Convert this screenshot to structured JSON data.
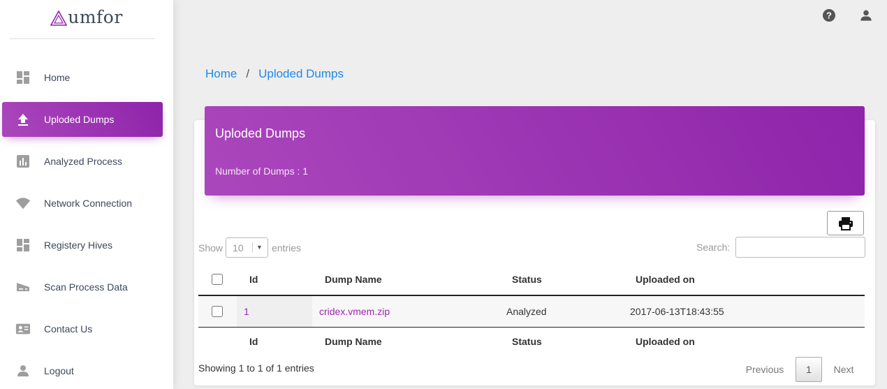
{
  "brand": {
    "logo_text": "umfor",
    "accent": "#9c27b0"
  },
  "sidebar": {
    "items": [
      {
        "label": "Home",
        "icon": "dashboard-icon",
        "active": false
      },
      {
        "label": "Uploded Dumps",
        "icon": "upload-icon",
        "active": true
      },
      {
        "label": "Analyzed Process",
        "icon": "bar-chart-icon",
        "active": false
      },
      {
        "label": "Network Connection",
        "icon": "wifi-icon",
        "active": false
      },
      {
        "label": "Registery Hives",
        "icon": "dashboard-icon",
        "active": false
      },
      {
        "label": "Scan Process Data",
        "icon": "scanner-icon",
        "active": false
      },
      {
        "label": "Contact Us",
        "icon": "contact-card-icon",
        "active": false
      },
      {
        "label": "Logout",
        "icon": "person-icon",
        "active": false
      }
    ]
  },
  "topbar": {
    "help_icon": "help-icon",
    "user_icon": "person-icon"
  },
  "breadcrumb": {
    "home": "Home",
    "separator": "/",
    "current": "Uploded Dumps"
  },
  "card": {
    "title": "Uploded Dumps",
    "subtitle": "Number of Dumps : 1",
    "print_icon": "print-icon"
  },
  "table_controls": {
    "show_label": "Show",
    "entries_label": "entries",
    "length_value": "10",
    "search_label": "Search:",
    "search_value": ""
  },
  "table": {
    "columns": [
      "Id",
      "Dump Name",
      "Status",
      "Uploaded on"
    ],
    "rows": [
      {
        "id": "1",
        "dump_name": "cridex.vmem.zip",
        "status": "Analyzed",
        "uploaded_on": "2017-06-13T18:43:55"
      }
    ]
  },
  "pagination": {
    "info": "Showing 1 to 1 of 1 entries",
    "previous": "Previous",
    "page": "1",
    "next": "Next"
  }
}
